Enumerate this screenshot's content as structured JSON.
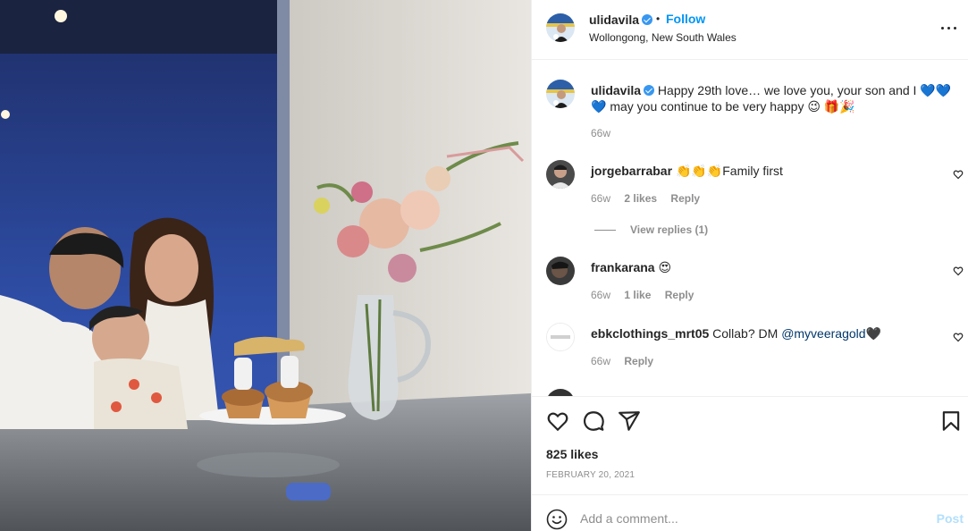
{
  "post": {
    "author": {
      "username": "ulidavila",
      "verified": true,
      "follow_label": "Follow",
      "separator": "•",
      "location": "Wollongong, New South Wales"
    },
    "caption": {
      "username": "ulidavila",
      "text": "Happy 29th love… we love you, your son and I 💙💙💙 may you continue to be very happy 😉 🎁🎉",
      "time": "66w"
    },
    "comments": [
      {
        "username": "jorgebarrabar",
        "text": "👏👏👏Family first",
        "time": "66w",
        "likes": "2 likes",
        "reply_label": "Reply",
        "view_replies": "View replies (1)"
      },
      {
        "username": "frankarana",
        "text": "😍",
        "time": "66w",
        "likes": "1 like",
        "reply_label": "Reply"
      },
      {
        "username": "ebkclothings_mrt05",
        "text": "Collab? DM ",
        "mention": "@myveeragold",
        "text_tail": "🖤",
        "time": "66w",
        "reply_label": "Reply"
      }
    ],
    "likes": "825 likes",
    "date": "FEBRUARY 20, 2021",
    "add_comment": {
      "placeholder": "Add a comment...",
      "post_label": "Post"
    },
    "icons": [
      "more-icon",
      "heart-icon",
      "comment-icon",
      "share-icon",
      "bookmark-icon",
      "emoji-icon"
    ],
    "colors": {
      "accent": "#0095f6",
      "verified": "#3897f0",
      "muted": "#8e8e8e",
      "post_disabled": "#b2dffc"
    }
  }
}
